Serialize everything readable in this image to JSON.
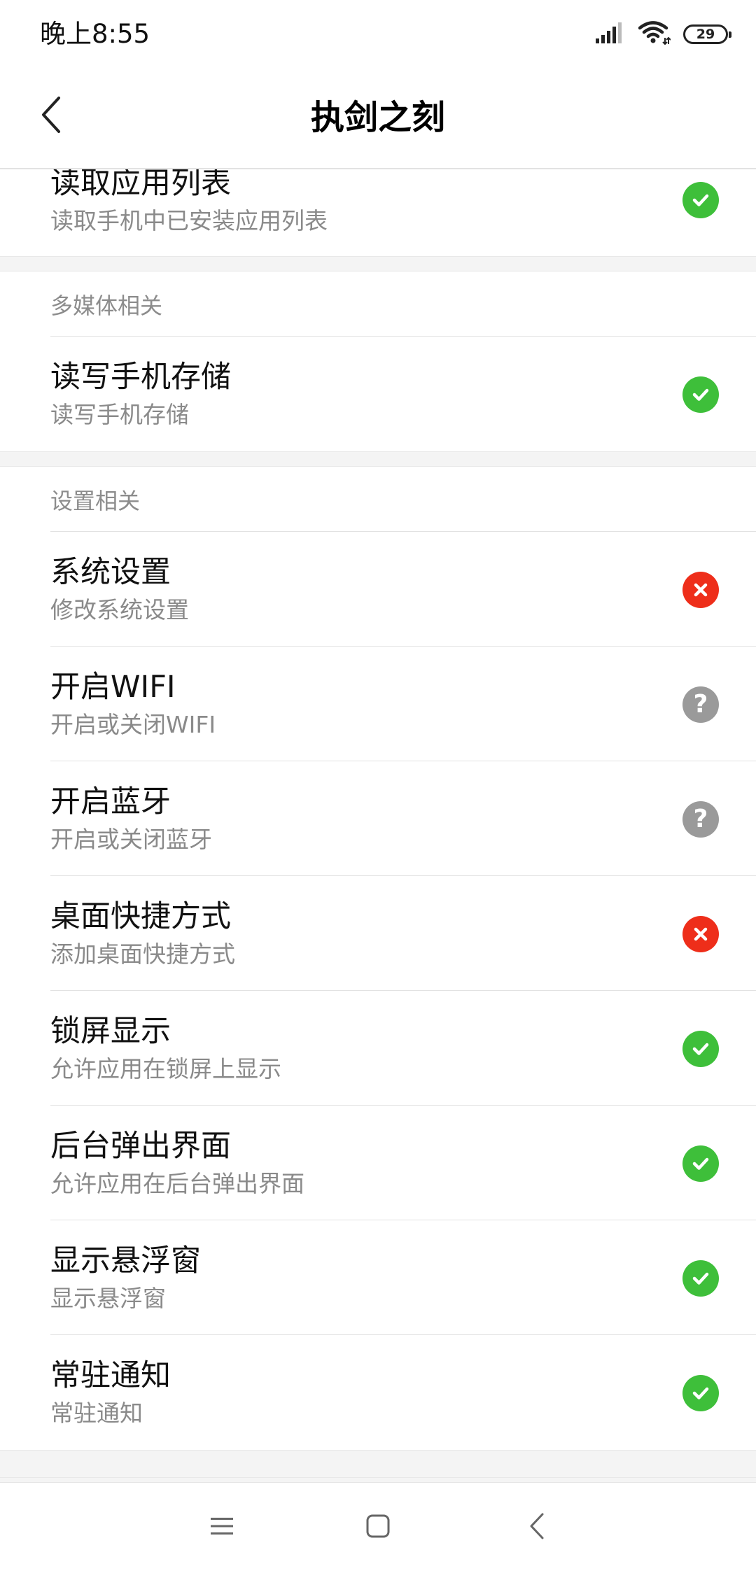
{
  "status_bar": {
    "time": "晚上8:55",
    "battery": "29",
    "icons": [
      "signal-icon",
      "wifi-icon",
      "battery-icon"
    ]
  },
  "header": {
    "title": "执剑之刻",
    "back_icon": "chevron-left-icon"
  },
  "colors": {
    "granted": "#3ebf3a",
    "denied": "#ee2e1a",
    "ask": "#9a9a9a"
  },
  "sections": [
    {
      "header": "",
      "items": [
        {
          "title": "读取应用列表",
          "desc": "读取手机中已安装应用列表",
          "status": "granted"
        }
      ]
    },
    {
      "header": "多媒体相关",
      "items": [
        {
          "title": "读写手机存储",
          "desc": "读写手机存储",
          "status": "granted"
        }
      ]
    },
    {
      "header": "设置相关",
      "items": [
        {
          "title": "系统设置",
          "desc": "修改系统设置",
          "status": "denied"
        },
        {
          "title": "开启WIFI",
          "desc": "开启或关闭WIFI",
          "status": "ask"
        },
        {
          "title": "开启蓝牙",
          "desc": "开启或关闭蓝牙",
          "status": "ask"
        },
        {
          "title": "桌面快捷方式",
          "desc": "添加桌面快捷方式",
          "status": "denied"
        },
        {
          "title": "锁屏显示",
          "desc": "允许应用在锁屏上显示",
          "status": "granted"
        },
        {
          "title": "后台弹出界面",
          "desc": "允许应用在后台弹出界面",
          "status": "granted"
        },
        {
          "title": "显示悬浮窗",
          "desc": "显示悬浮窗",
          "status": "granted"
        },
        {
          "title": "常驻通知",
          "desc": "常驻通知",
          "status": "granted"
        }
      ]
    }
  ],
  "nav_bar": {
    "icons": [
      "menu-icon",
      "home-icon",
      "back-icon"
    ]
  }
}
